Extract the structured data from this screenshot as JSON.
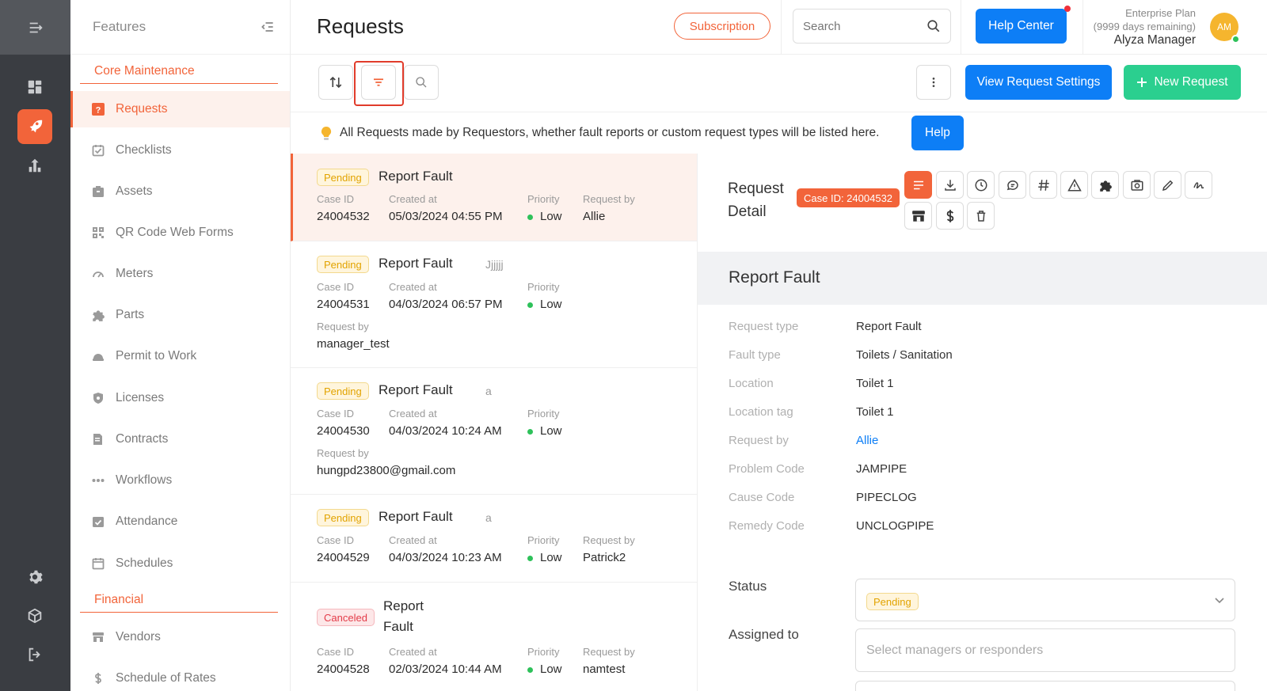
{
  "sidebar": {
    "title": "Features",
    "sections": [
      {
        "label": "Core Maintenance"
      },
      {
        "label": "Financial"
      }
    ],
    "items": [
      {
        "label": "Requests",
        "icon": "question-square-icon"
      },
      {
        "label": "Checklists",
        "icon": "checklist-icon"
      },
      {
        "label": "Assets",
        "icon": "assets-icon"
      },
      {
        "label": "QR Code Web Forms",
        "icon": "qr-code-icon"
      },
      {
        "label": "Meters",
        "icon": "gauge-icon"
      },
      {
        "label": "Parts",
        "icon": "puzzle-icon"
      },
      {
        "label": "Permit to Work",
        "icon": "hard-hat-icon"
      },
      {
        "label": "Licenses",
        "icon": "shield-icon"
      },
      {
        "label": "Contracts",
        "icon": "contract-icon"
      },
      {
        "label": "Workflows",
        "icon": "workflow-icon"
      },
      {
        "label": "Attendance",
        "icon": "attendance-icon"
      },
      {
        "label": "Schedules",
        "icon": "calendar-icon"
      },
      {
        "label": "Vendors",
        "icon": "store-icon"
      },
      {
        "label": "Schedule of Rates",
        "icon": "dollar-icon"
      }
    ]
  },
  "header": {
    "title": "Requests",
    "subscription_label": "Subscription",
    "search_placeholder": "Search",
    "help_center_label": "Help Center",
    "plan_name": "Enterprise Plan",
    "plan_remaining": "(9999 days remaining)",
    "user_name": "Alyza Manager",
    "avatar_initials": "AM"
  },
  "toolbar": {
    "view_settings_label": "View Request Settings",
    "new_request_label": "New Request"
  },
  "info": {
    "text": "All Requests made by Requestors, whether fault reports or custom request types will be listed here.",
    "help_label": "Help"
  },
  "labels": {
    "case_id": "Case ID",
    "created_at": "Created at",
    "priority": "Priority",
    "request_by": "Request by"
  },
  "requests": [
    {
      "status": "Pending",
      "title": "Report Fault",
      "extra": "",
      "case_id": "24004532",
      "created_at": "05/03/2024 04:55 PM",
      "priority": "Low",
      "request_by": "Allie"
    },
    {
      "status": "Pending",
      "title": "Report Fault",
      "extra": "Jjjjjj",
      "case_id": "24004531",
      "created_at": "04/03/2024 06:57 PM",
      "priority": "Low",
      "request_by": "manager_test"
    },
    {
      "status": "Pending",
      "title": "Report Fault",
      "extra": "a",
      "case_id": "24004530",
      "created_at": "04/03/2024 10:24 AM",
      "priority": "Low",
      "request_by": "hungpd23800@gmail.com"
    },
    {
      "status": "Pending",
      "title": "Report Fault",
      "extra": "a",
      "case_id": "24004529",
      "created_at": "04/03/2024 10:23 AM",
      "priority": "Low",
      "request_by": "Patrick2"
    },
    {
      "status": "Canceled",
      "title_line1": "Report",
      "title_line2": "Fault",
      "case_id": "24004528",
      "created_at": "02/03/2024 10:44 AM",
      "priority": "Low",
      "request_by": "namtest"
    }
  ],
  "detail": {
    "title_line1": "Request",
    "title_line2": "Detail",
    "case_badge": "Case ID: 24004532",
    "heading": "Report Fault",
    "fields": [
      {
        "label": "Request type",
        "value": "Report Fault"
      },
      {
        "label": "Fault type",
        "value": "Toilets / Sanitation"
      },
      {
        "label": "Location",
        "value": "Toilet 1"
      },
      {
        "label": "Location tag",
        "value": "Toilet 1"
      },
      {
        "label": "Request by",
        "value": "Allie"
      },
      {
        "label": "Problem Code",
        "value": "JAMPIPE"
      },
      {
        "label": "Cause Code",
        "value": "PIPECLOG"
      },
      {
        "label": "Remedy Code",
        "value": "UNCLOGPIPE"
      }
    ],
    "status_label": "Status",
    "status_value": "Pending",
    "assigned_label": "Assigned to",
    "assigned_placeholder": "Select managers or responders"
  },
  "colors": {
    "accent": "#f2643a",
    "primary": "#0d7ef6",
    "success": "#2bcf8f",
    "rail": "#3a3d42"
  }
}
